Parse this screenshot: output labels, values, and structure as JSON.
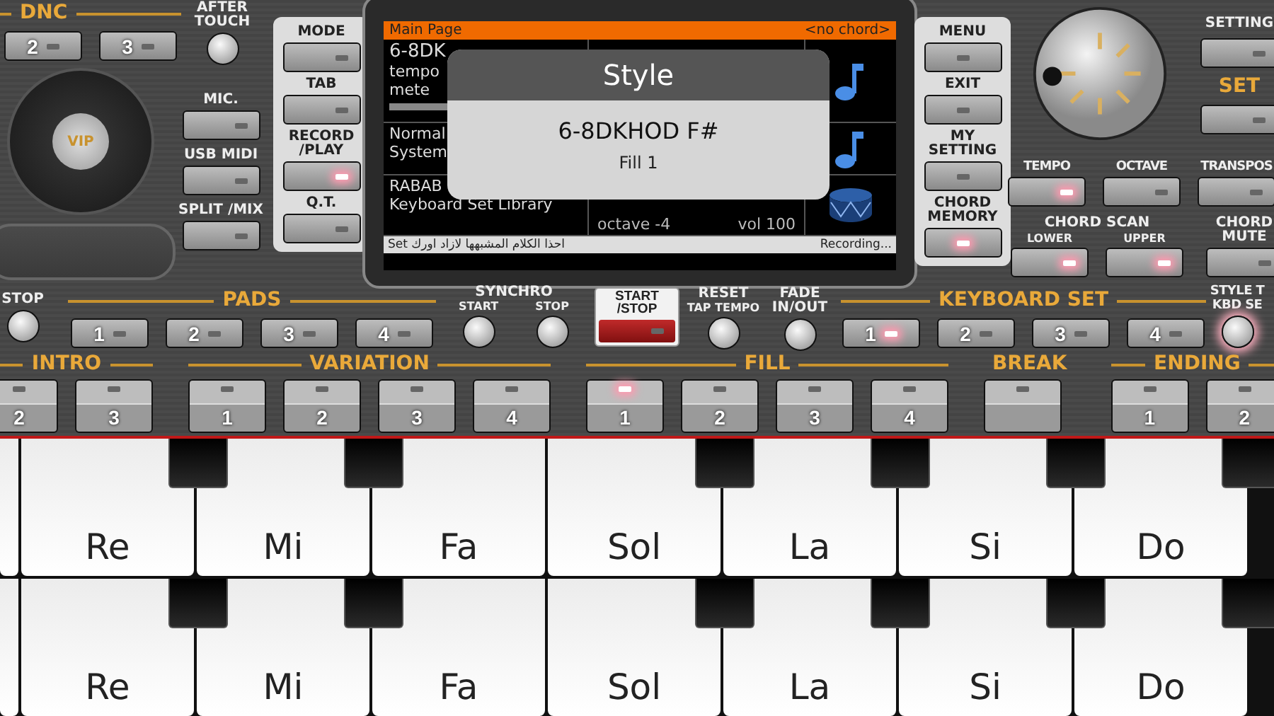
{
  "dnc": {
    "label": "DNC",
    "buttons": [
      {
        "label": "2",
        "lit": false
      },
      {
        "label": "3",
        "lit": false
      }
    ]
  },
  "after_touch": {
    "label": "AFTER TOUCH",
    "lit": false
  },
  "jog": {
    "logo": "VIP"
  },
  "left_buttons": [
    {
      "label": "MIC.",
      "lit": false
    },
    {
      "label": "USB MIDI",
      "lit": false
    },
    {
      "label": "SPLIT /MIX",
      "lit": false
    }
  ],
  "mode_buttons": [
    {
      "label": "MODE",
      "lit": false
    },
    {
      "label": "TAB",
      "lit": false
    },
    {
      "label": "RECORD /PLAY",
      "lit": true
    },
    {
      "label": "Q.T.",
      "lit": false
    }
  ],
  "screen": {
    "title": "Main Page",
    "chord": "<no chord>",
    "rows": [
      {
        "kind": "style",
        "texts": [
          "6-8DK",
          "tempo",
          "mete"
        ]
      },
      {
        "kind": "voice",
        "texts": [
          "Normal",
          "System"
        ]
      },
      {
        "kind": "keyboard",
        "texts": [
          "RABAB",
          "Keyboard Set Library"
        ],
        "octave": "octave -4",
        "volume": "vol 100"
      }
    ],
    "status_left": "Set احذا الكلام المشبهها لازاد اورك",
    "status_right": "Recording...",
    "popup": {
      "title": "Style",
      "name": "6-8DKHOD F#",
      "detail": "Fill 1"
    }
  },
  "menu_buttons": [
    {
      "label": "MENU",
      "lit": false
    },
    {
      "label": "EXIT",
      "lit": false
    },
    {
      "label": "MY SETTING",
      "lit": false
    },
    {
      "label": "CHORD MEMORY",
      "lit": true
    }
  ],
  "setting": {
    "label": "SETTING",
    "lit": false
  },
  "set": {
    "label": "SET",
    "lit": false
  },
  "tempo_row": [
    {
      "label": "TEMPO",
      "lit": true
    },
    {
      "label": "OCTAVE",
      "lit": false
    },
    {
      "label": "TRANSPOS",
      "lit": false
    }
  ],
  "chord_scan": {
    "label": "CHORD SCAN",
    "buttons": [
      {
        "label": "LOWER",
        "lit": true
      },
      {
        "label": "UPPER",
        "lit": true
      }
    ]
  },
  "chord_mute": {
    "label": "CHORD MUTE",
    "lit": false
  },
  "stop": {
    "label": "STOP",
    "lit": false
  },
  "pads": {
    "label": "PADS",
    "buttons": [
      {
        "label": "1",
        "lit": false
      },
      {
        "label": "2",
        "lit": false
      },
      {
        "label": "3",
        "lit": false
      },
      {
        "label": "4",
        "lit": false
      }
    ]
  },
  "synchro": {
    "label": "SYNCHRO",
    "knobs": [
      {
        "label": "START",
        "lit": false
      },
      {
        "label": "STOP",
        "lit": false
      }
    ]
  },
  "start_stop": {
    "label": "START /STOP",
    "lit": false
  },
  "reset": {
    "label": "RESET",
    "sub": "TAP TEMPO",
    "lit": false
  },
  "fade": {
    "label": "FADE IN/OUT",
    "lit": false
  },
  "keyboard_set": {
    "label": "KEYBOARD SET",
    "buttons": [
      {
        "label": "1",
        "lit": true
      },
      {
        "label": "2",
        "lit": false
      },
      {
        "label": "3",
        "lit": false
      },
      {
        "label": "4",
        "lit": false
      }
    ]
  },
  "style_kbd": {
    "label": "STYLE T KBD SE",
    "lit": true
  },
  "sections": [
    {
      "label": "INTRO",
      "buttons": [
        {
          "label": "2",
          "lit": false
        },
        {
          "label": "3",
          "lit": false
        }
      ]
    },
    {
      "label": "VARIATION",
      "buttons": [
        {
          "label": "1",
          "lit": false
        },
        {
          "label": "2",
          "lit": false
        },
        {
          "label": "3",
          "lit": false
        },
        {
          "label": "4",
          "lit": false
        }
      ]
    },
    {
      "label": "FILL",
      "buttons": [
        {
          "label": "1",
          "lit": true
        },
        {
          "label": "2",
          "lit": false
        },
        {
          "label": "3",
          "lit": false
        },
        {
          "label": "4",
          "lit": false
        }
      ]
    },
    {
      "label": "BREAK",
      "buttons": [
        {
          "lit": false
        }
      ]
    },
    {
      "label": "ENDING",
      "buttons": [
        {
          "label": "1",
          "lit": false
        },
        {
          "label": "2",
          "lit": false
        }
      ]
    }
  ],
  "keyboard_rows": [
    {
      "keys": [
        "Re",
        "Mi",
        "Fa",
        "Sol",
        "La",
        "Si",
        "Do"
      ]
    },
    {
      "keys": [
        "Re",
        "Mi",
        "Fa",
        "Sol",
        "La",
        "Si",
        "Do"
      ]
    }
  ]
}
